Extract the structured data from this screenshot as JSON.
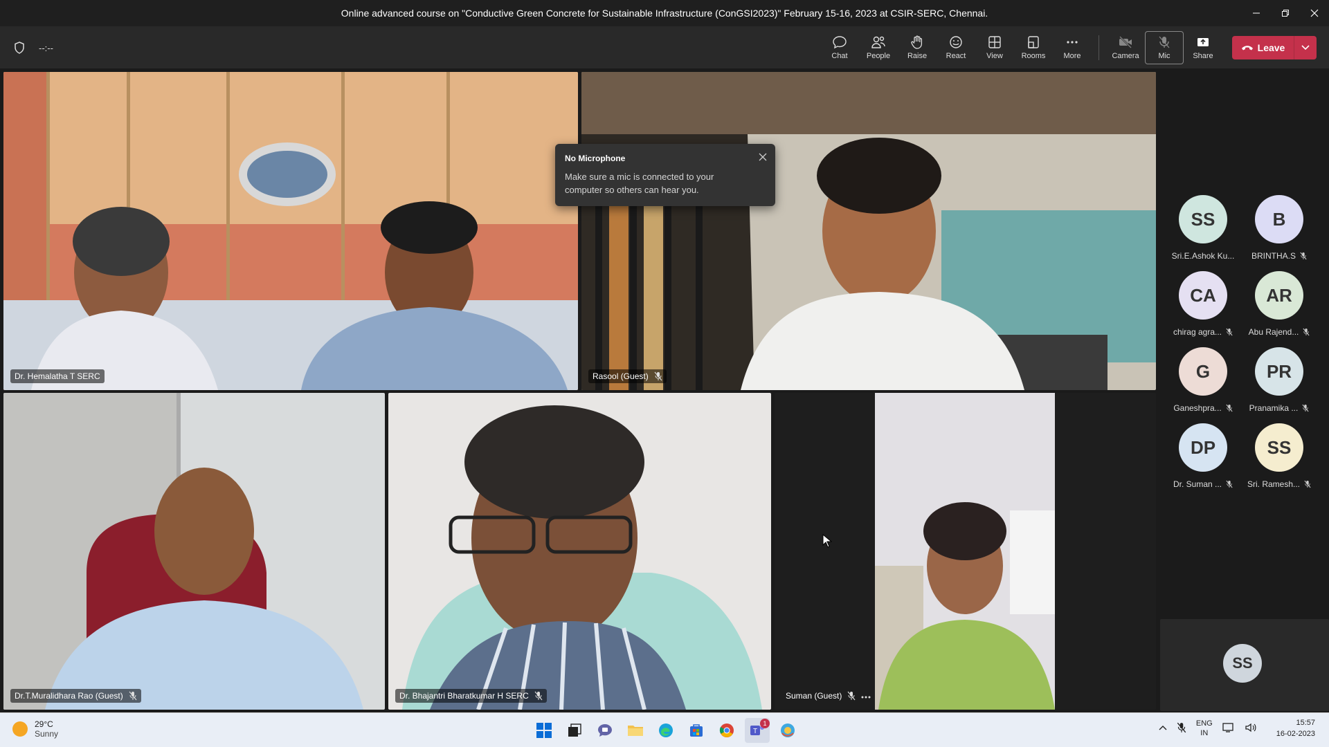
{
  "window": {
    "title": "Online advanced course on \"Conductive Green Concrete for Sustainable Infrastructure (ConGSI2023)\" February 15-16, 2023 at CSIR-SERC, Chennai."
  },
  "toolbar": {
    "timer": "--:--",
    "buttons": {
      "chat": "Chat",
      "people": "People",
      "raise": "Raise",
      "react": "React",
      "view": "View",
      "rooms": "Rooms",
      "more": "More",
      "camera": "Camera",
      "mic": "Mic",
      "share": "Share"
    },
    "leave_label": "Leave"
  },
  "toast": {
    "title": "No Microphone",
    "body": "Make sure a mic is connected to your computer so others can hear you."
  },
  "videos": [
    {
      "name": "Dr. Hemalatha T SERC"
    },
    {
      "name": "Rasool (Guest)"
    },
    {
      "name": "Dr.T.Muralidhara Rao (Guest)"
    },
    {
      "name": "Dr. Bhajantri Bharatkumar H SERC"
    },
    {
      "name": "Suman (Guest)"
    }
  ],
  "roster": [
    {
      "initials": "SS",
      "name": "Sri.E.Ashok Ku...",
      "color": "#cfe6df"
    },
    {
      "initials": "B",
      "name": "BRINTHA.S",
      "color": "#dcdcf5"
    },
    {
      "initials": "CA",
      "name": "chirag agra...",
      "color": "#e5e0f2"
    },
    {
      "initials": "AR",
      "name": "Abu Rajend...",
      "color": "#d9e8d6"
    },
    {
      "initials": "G",
      "name": "Ganeshpra...",
      "color": "#eddcd6"
    },
    {
      "initials": "PR",
      "name": "Pranamika ...",
      "color": "#d7e4e8"
    },
    {
      "initials": "DP",
      "name": "Dr. Suman ...",
      "color": "#d6e4f2"
    },
    {
      "initials": "SS",
      "name": "Sri. Ramesh...",
      "color": "#f5edcf"
    }
  ],
  "self_tile": {
    "initials": "SS"
  },
  "taskbar": {
    "temperature": "29°C",
    "condition": "Sunny",
    "lang_line1": "ENG",
    "lang_line2": "IN",
    "time": "15:57",
    "date": "16-02-2023",
    "teams_badge": "1"
  }
}
